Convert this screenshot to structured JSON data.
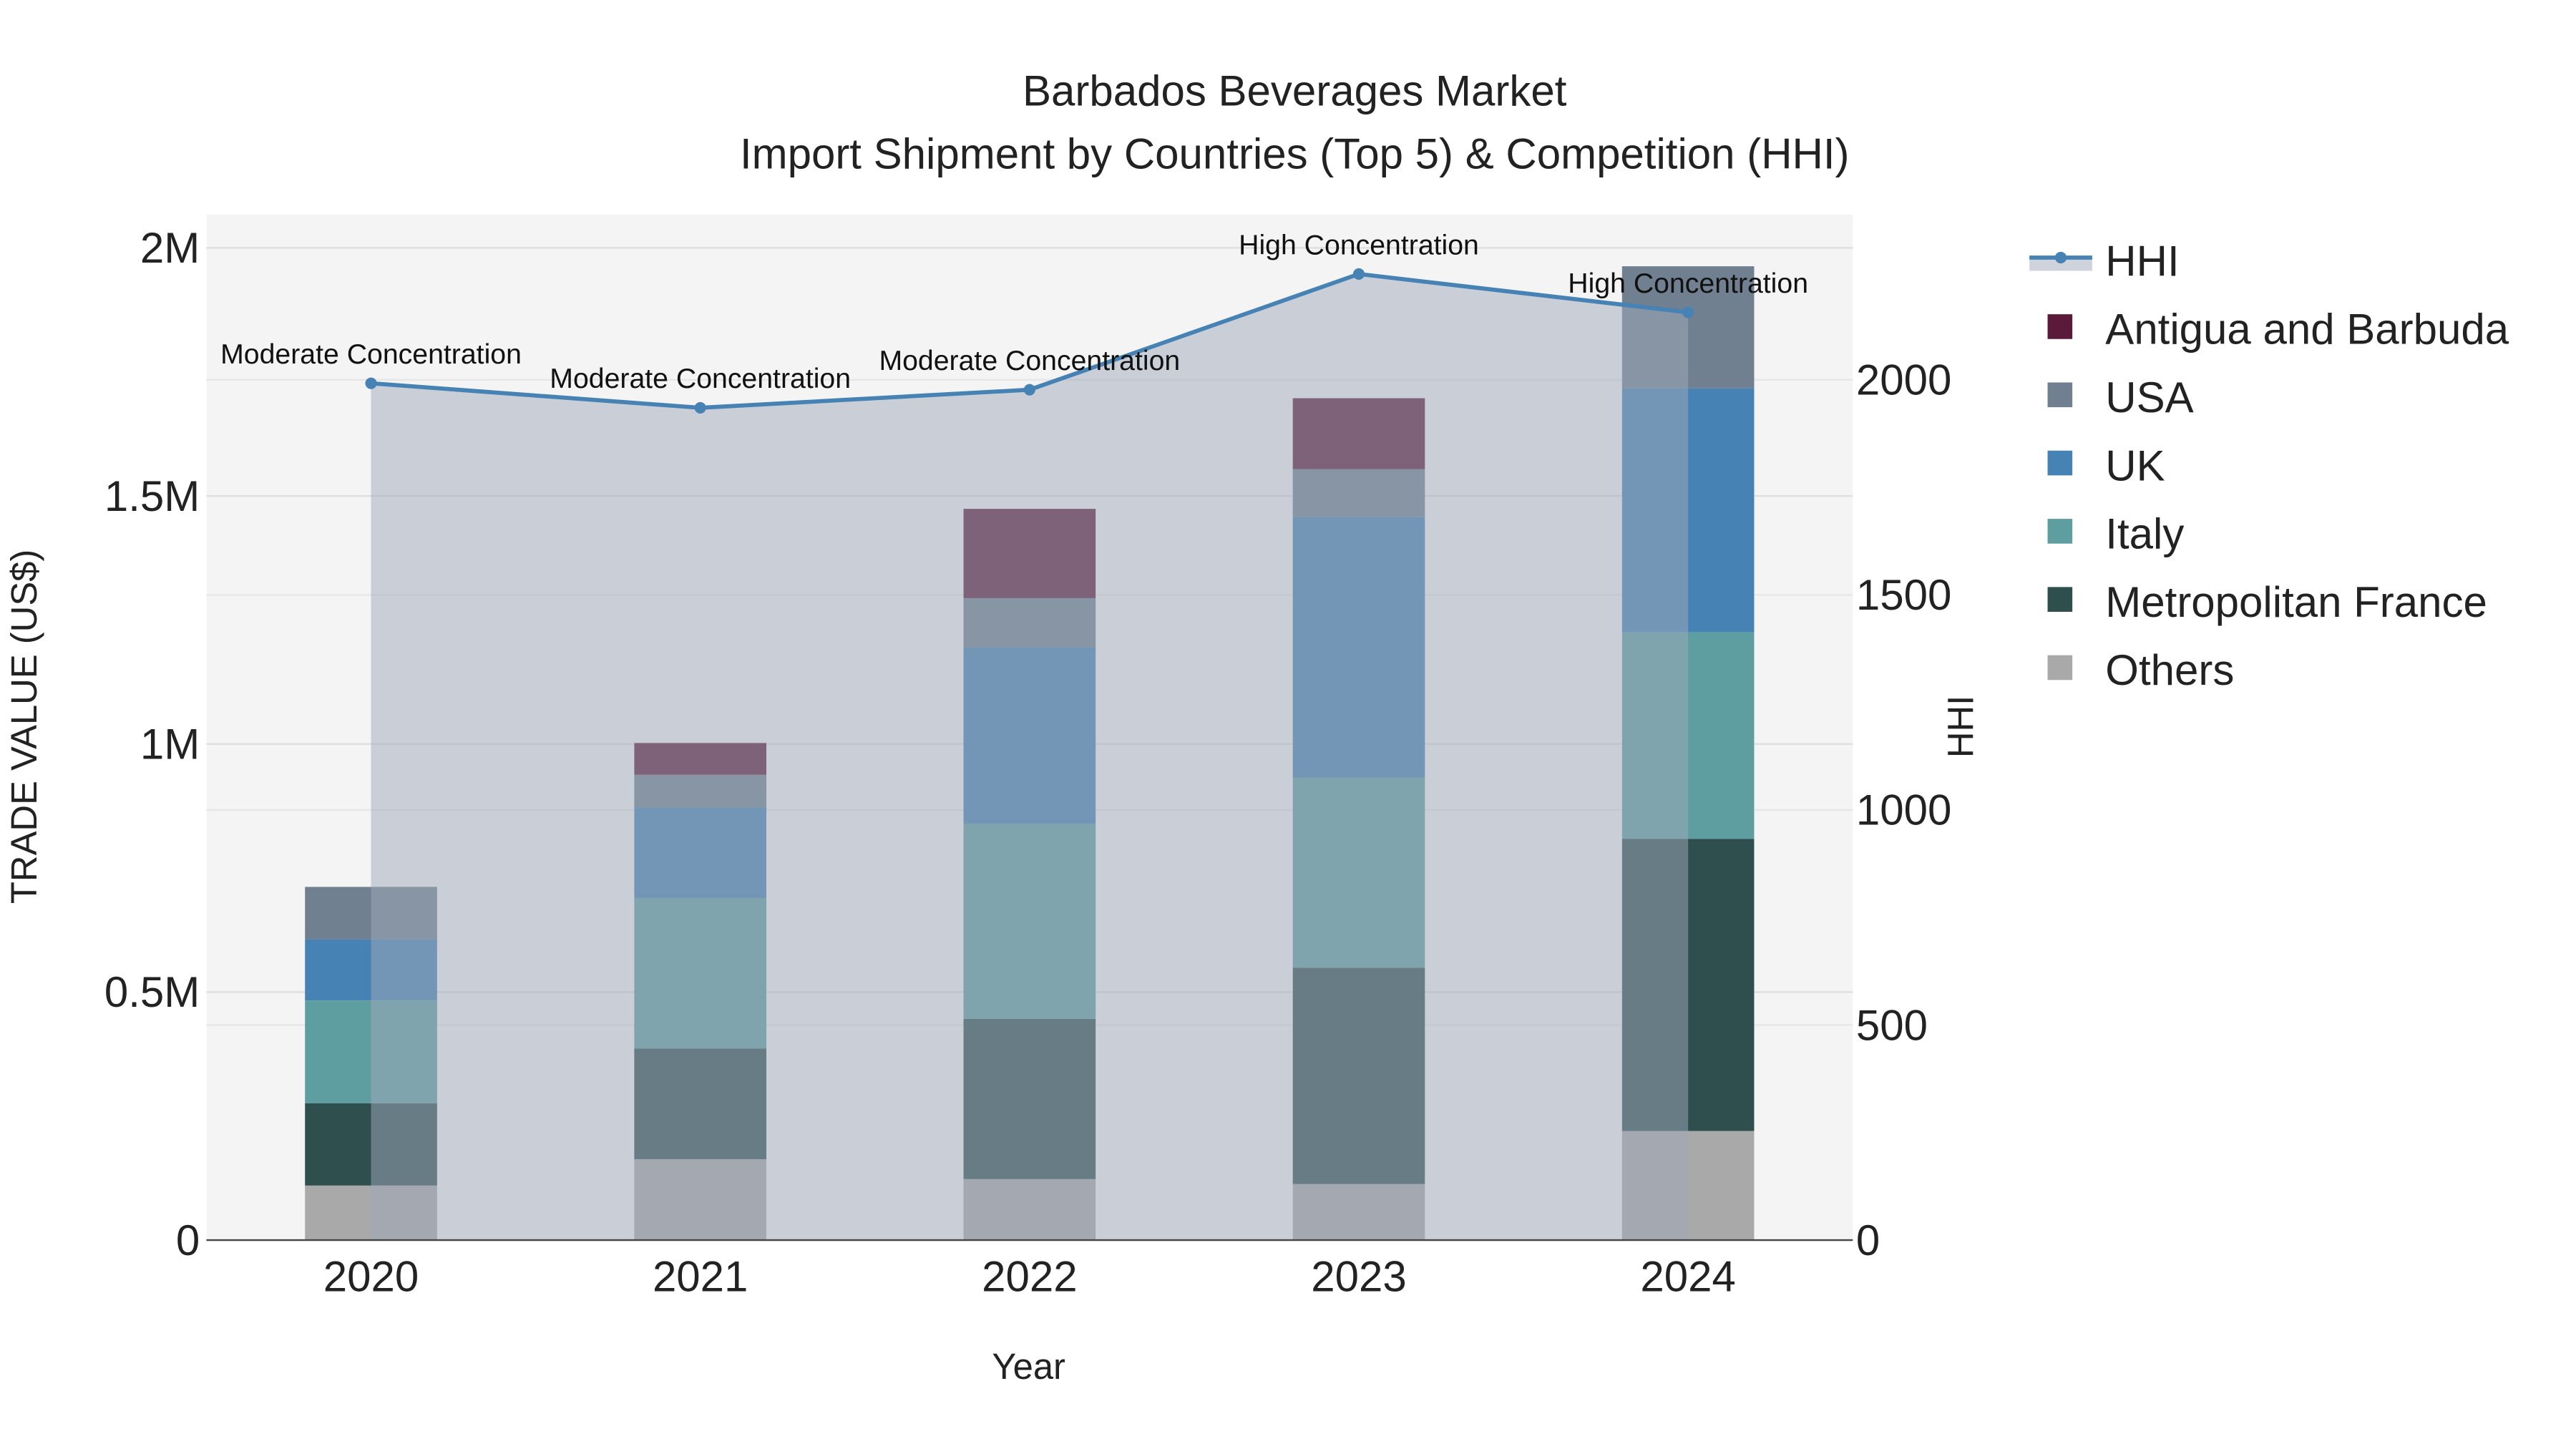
{
  "chart_data": {
    "type": "bar",
    "title": "Barbados Beverages Market",
    "subtitle": "Import Shipment by Countries (Top 5) & Competition (HHI)",
    "xlabel": "Year",
    "ylabel": "TRADE VALUE (US$)",
    "y2label": "HHI",
    "categories": [
      "2020",
      "2021",
      "2022",
      "2023",
      "2024"
    ],
    "ylim": [
      0,
      2067000
    ],
    "y2lim": [
      0,
      2384
    ],
    "yticks": [
      0,
      500000,
      1000000,
      1500000,
      2000000
    ],
    "ytick_labels": [
      "0",
      "0.5M",
      "1M",
      "1.5M",
      "2M"
    ],
    "y2ticks": [
      0,
      500,
      1000,
      1500,
      2000
    ],
    "y2tick_labels": [
      "0",
      "500",
      "1000",
      "1500",
      "2000"
    ],
    "grid": true,
    "stacked": true,
    "legend_position": "right",
    "series": [
      {
        "name": "Others",
        "color": "#a9a9a9",
        "values": [
          110000,
          163000,
          123000,
          113000,
          220000
        ]
      },
      {
        "name": "Metropolitan France",
        "color": "#2f4f4f",
        "values": [
          166000,
          223000,
          323000,
          436000,
          589000
        ]
      },
      {
        "name": "Italy",
        "color": "#5f9ea0",
        "values": [
          207000,
          303000,
          393000,
          383000,
          416000
        ]
      },
      {
        "name": "UK",
        "color": "#4682b4",
        "values": [
          123000,
          183000,
          356000,
          526000,
          492000
        ]
      },
      {
        "name": "USA",
        "color": "#708090",
        "values": [
          106000,
          66000,
          99000,
          96000,
          246000
        ]
      },
      {
        "name": "Antigua and Barbuda",
        "color": "#5c1a3b",
        "values": [
          0,
          64000,
          180000,
          143000,
          0
        ]
      }
    ],
    "hhi": {
      "name": "HHI",
      "color": "#4682b4",
      "values": [
        1992,
        1935,
        1977,
        2246,
        2157
      ],
      "annotations": [
        "Moderate Concentration",
        "Moderate Concentration",
        "Moderate Concentration",
        "High Concentration",
        "High Concentration"
      ]
    },
    "legend_order": [
      "HHI",
      "Antigua and Barbuda",
      "USA",
      "UK",
      "Italy",
      "Metropolitan France",
      "Others"
    ]
  }
}
